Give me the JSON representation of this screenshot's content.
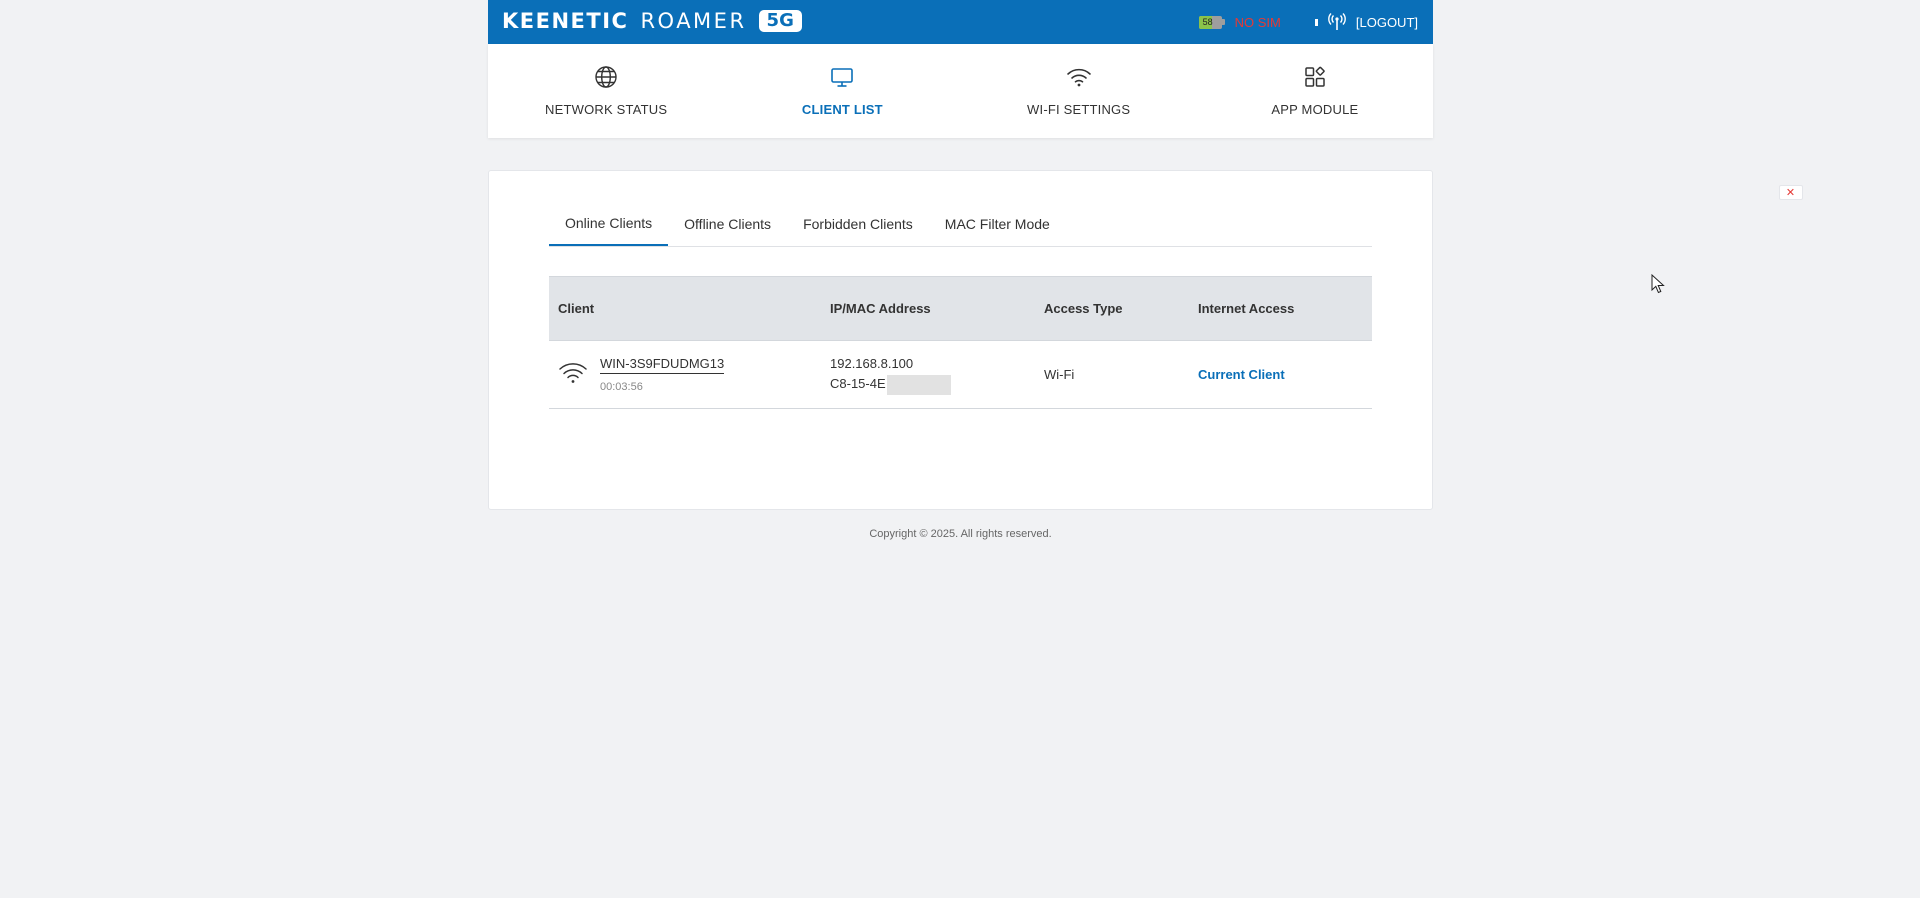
{
  "header": {
    "brand_word1": "KEENETIC",
    "brand_word2": "ROAMER",
    "brand_badge": "5G",
    "battery_percent": "58",
    "battery_level": 0.58,
    "sim_status": "NO SIM",
    "logout_label": "[LOGOUT]",
    "bar_color": "#0a6fb8"
  },
  "nav": {
    "items": [
      {
        "label": "NETWORK STATUS",
        "icon": "globe-icon"
      },
      {
        "label": "CLIENT LIST",
        "icon": "monitor-icon",
        "active": true
      },
      {
        "label": "WI-FI SETTINGS",
        "icon": "wifi-icon"
      },
      {
        "label": "APP MODULE",
        "icon": "apps-grid-icon"
      }
    ]
  },
  "tabs": [
    {
      "label": "Online Clients",
      "active": true
    },
    {
      "label": "Offline Clients"
    },
    {
      "label": "Forbidden Clients"
    },
    {
      "label": "MAC Filter Mode"
    }
  ],
  "table": {
    "columns": [
      "Client",
      "IP/MAC Address",
      "Access Type",
      "Internet Access"
    ],
    "rows": [
      {
        "icon": "wifi-icon",
        "name": "WIN-3S9FDUDMG13",
        "duration": "00:03:56",
        "ip": "192.168.8.100",
        "mac": "C8-15-4E",
        "access_type": "Wi-Fi",
        "internet_access": "Current Client"
      }
    ]
  },
  "footer": {
    "copyright": "Copyright © 2025. All rights reserved."
  }
}
